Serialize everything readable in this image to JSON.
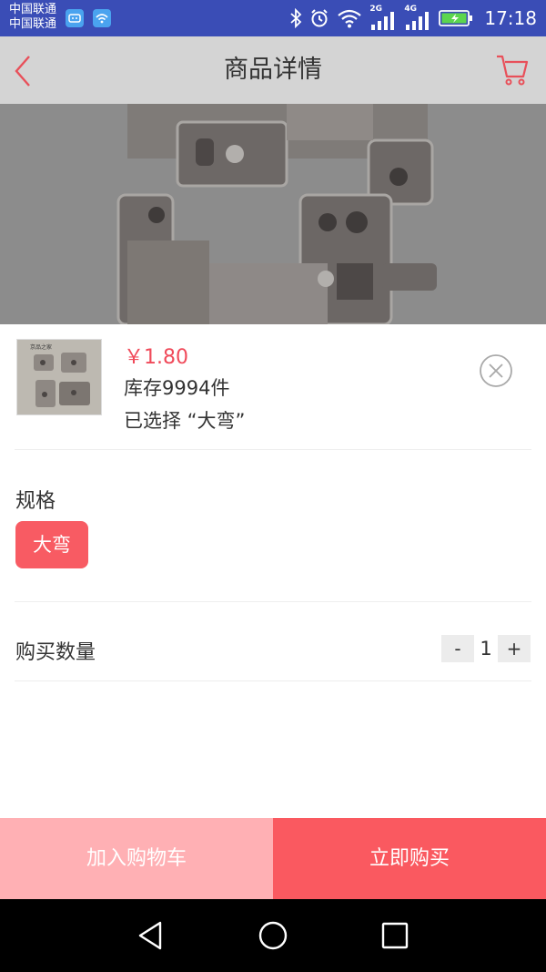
{
  "status_bar": {
    "carrier_1": "中国联通",
    "carrier_2": "中国联通",
    "network_1": "2G",
    "network_2": "4G",
    "time": "17:18"
  },
  "header": {
    "title": "商品详情",
    "back_icon": "chevron-left-icon",
    "cart_icon": "shopping-cart-icon"
  },
  "product": {
    "price": "￥1.80",
    "stock": "库存9994件",
    "selected": "已选择 “大弯”",
    "thumb_caption": "京品之家"
  },
  "spec": {
    "label": "规格",
    "options": [
      "大弯"
    ],
    "selected_option": "大弯"
  },
  "quantity": {
    "label": "购买数量",
    "minus": "-",
    "value": "1",
    "plus": "+"
  },
  "actions": {
    "add_to_cart": "加入购物车",
    "buy_now": "立即购买"
  },
  "colors": {
    "status_bar": "#3a4db6",
    "accent": "#fa5960",
    "accent_light": "#ffb0b4",
    "price": "#f04a5a"
  }
}
